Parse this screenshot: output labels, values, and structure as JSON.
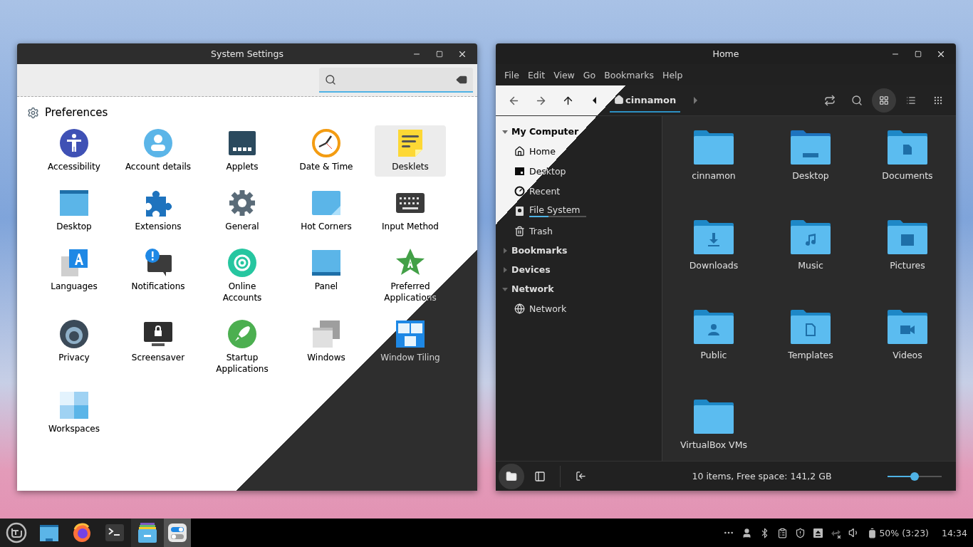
{
  "settings_window": {
    "title": "System Settings",
    "section": "Preferences",
    "items": [
      {
        "label": "Accessibility",
        "selected": false
      },
      {
        "label": "Account details",
        "selected": false
      },
      {
        "label": "Applets",
        "selected": false
      },
      {
        "label": "Date & Time",
        "selected": false
      },
      {
        "label": "Desklets",
        "selected": true
      },
      {
        "label": "Desktop",
        "selected": false
      },
      {
        "label": "Extensions",
        "selected": false
      },
      {
        "label": "General",
        "selected": false
      },
      {
        "label": "Hot Corners",
        "selected": false
      },
      {
        "label": "Input Method",
        "selected": false
      },
      {
        "label": "Languages",
        "selected": false
      },
      {
        "label": "Notifications",
        "selected": false
      },
      {
        "label": "Online Accounts",
        "selected": false
      },
      {
        "label": "Panel",
        "selected": false
      },
      {
        "label": "Preferred Applications",
        "selected": false
      },
      {
        "label": "Privacy",
        "selected": false
      },
      {
        "label": "Screensaver",
        "selected": false
      },
      {
        "label": "Startup Applications",
        "selected": false
      },
      {
        "label": "Windows",
        "selected": false
      },
      {
        "label": "Window Tiling",
        "selected": false
      },
      {
        "label": "Workspaces",
        "selected": false
      }
    ]
  },
  "file_window": {
    "title": "Home",
    "menu": [
      "File",
      "Edit",
      "View",
      "Go",
      "Bookmarks",
      "Help"
    ],
    "toolbar": {
      "back_disabled": true,
      "forward_disabled": true,
      "path": [
        {
          "label": "cinnamon",
          "selected": true
        }
      ],
      "views": [
        {
          "selected": true
        },
        {
          "selected": false
        },
        {
          "selected": false
        }
      ]
    },
    "sidebar": [
      {
        "label": "My Computer",
        "expanded": true,
        "children": [
          {
            "label": "Home",
            "selected": false
          },
          {
            "label": "Desktop",
            "selected": false
          },
          {
            "label": "Recent",
            "selected": false
          },
          {
            "label": "File System",
            "selected": false,
            "level": 0.34
          },
          {
            "label": "Trash",
            "selected": false
          }
        ]
      },
      {
        "label": "Bookmarks",
        "expanded": false
      },
      {
        "label": "Devices",
        "expanded": false
      },
      {
        "label": "Network",
        "expanded": true,
        "children": [
          {
            "label": "Network",
            "selected": false
          }
        ]
      }
    ],
    "files": [
      {
        "name": "cinnamon"
      },
      {
        "name": "Desktop"
      },
      {
        "name": "Documents"
      },
      {
        "name": "Downloads"
      },
      {
        "name": "Music"
      },
      {
        "name": "Pictures"
      },
      {
        "name": "Public"
      },
      {
        "name": "Templates"
      },
      {
        "name": "Videos"
      },
      {
        "name": "VirtualBox VMs"
      }
    ],
    "status_bar": {
      "panes": [
        {
          "selected": true
        },
        {
          "selected": false
        }
      ],
      "text": "10 items, Free space: 141,2 GB",
      "zoom": {
        "level": 0.5
      }
    }
  },
  "taskbar": {
    "apps": [
      {
        "open": false,
        "selected": false
      },
      {
        "open": false,
        "selected": false
      },
      {
        "open": false,
        "selected": false
      },
      {
        "open": false,
        "selected": false
      },
      {
        "open": true,
        "selected": false
      },
      {
        "open": true,
        "selected": true
      }
    ],
    "battery": "50% (3:23)",
    "clock": "14:34"
  }
}
